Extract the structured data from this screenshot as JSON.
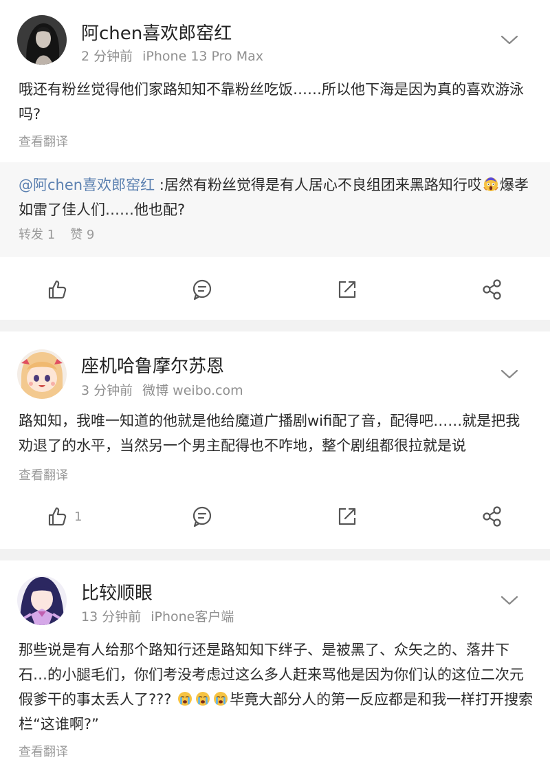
{
  "posts": [
    {
      "username": "阿chen喜欢郎窑红",
      "time": "2 分钟前",
      "source": "iPhone 13 Pro Max",
      "text": "哦还有粉丝觉得他们家路知知不靠粉丝吃饭……所以他下海是因为真的喜欢游泳吗?",
      "translate": "查看翻译",
      "quote": {
        "mention": "@阿chen喜欢郎窑红",
        "text_before_emoji": " :居然有粉丝觉得是有人居心不良组团来黑路知行哎",
        "emoji": "scream-emoji",
        "text_after_emoji": "爆孝如雷了佳人们……他也配?",
        "reposts": "转发 1",
        "likes": "赞 9"
      },
      "actions": {
        "like_count": ""
      }
    },
    {
      "username": "座机哈鲁摩尔苏恩",
      "time": "3 分钟前",
      "source": "微博 weibo.com",
      "text": "路知知，我唯一知道的他就是他给魔道广播剧wifi配了音，配得吧……就是把我劝退了的水平，当然另一个男主配得也不咋地，整个剧组都很拉就是说",
      "translate": "查看翻译",
      "actions": {
        "like_count": "1"
      }
    },
    {
      "username": "比较顺眼",
      "time": "13 分钟前",
      "source": "iPhone客户端",
      "text_before_emoji": "那些说是有人给那个路知行还是路知知下绊子、是被黑了、众矢之的、落井下石…的小腿毛们，你们考没考虑过这么多人赶来骂他是因为你们认的这位二次元假爹干的事太丢人了??? ",
      "emojis": [
        "cry-emoji",
        "cry-emoji",
        "cry-emoji"
      ],
      "text_after_emoji": "毕竟大部分人的第一反应都是和我一样打开搜索栏“这谁啊?”",
      "translate": "查看翻译"
    }
  ],
  "colors": {
    "mention": "#5b80b0",
    "meta": "#8f8f8f",
    "icon": "#555555",
    "background": "#f2f2f2"
  }
}
